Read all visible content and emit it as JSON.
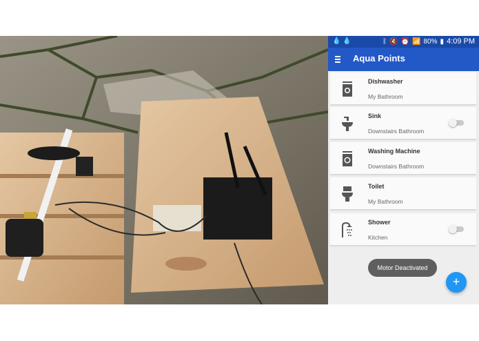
{
  "statusbar": {
    "left_icons": [
      "drop-icon",
      "drop-icon"
    ],
    "right_icons": [
      "bluetooth-icon",
      "mute-icon",
      "alarm-icon",
      "wifi-icon",
      "signal-icon"
    ],
    "battery": "80%",
    "time": "4:09 PM"
  },
  "appbar": {
    "title": "Aqua Points"
  },
  "devices": [
    {
      "name": "Dishwasher",
      "room": "My Bathroom",
      "icon": "dishwasher-icon",
      "has_toggle": false
    },
    {
      "name": "Sink",
      "room": "Downstairs Bathroom",
      "icon": "sink-icon",
      "has_toggle": true,
      "toggle_on": false
    },
    {
      "name": "Washing Machine",
      "room": "Downstairs Bathroom",
      "icon": "washing-machine-icon",
      "has_toggle": false
    },
    {
      "name": "Toilet",
      "room": "My Bathroom",
      "icon": "toilet-icon",
      "has_toggle": false
    },
    {
      "name": "Shower",
      "room": "Kitchen",
      "icon": "shower-icon",
      "has_toggle": true,
      "toggle_on": false
    }
  ],
  "snackbar": {
    "text": "Motor Deactivated"
  },
  "fab": {
    "label": "+"
  },
  "colors": {
    "appbar": "#2358c7",
    "statusbar": "#1a4aa8",
    "fab": "#2196f3",
    "snackbar": "#5f5f5f"
  }
}
